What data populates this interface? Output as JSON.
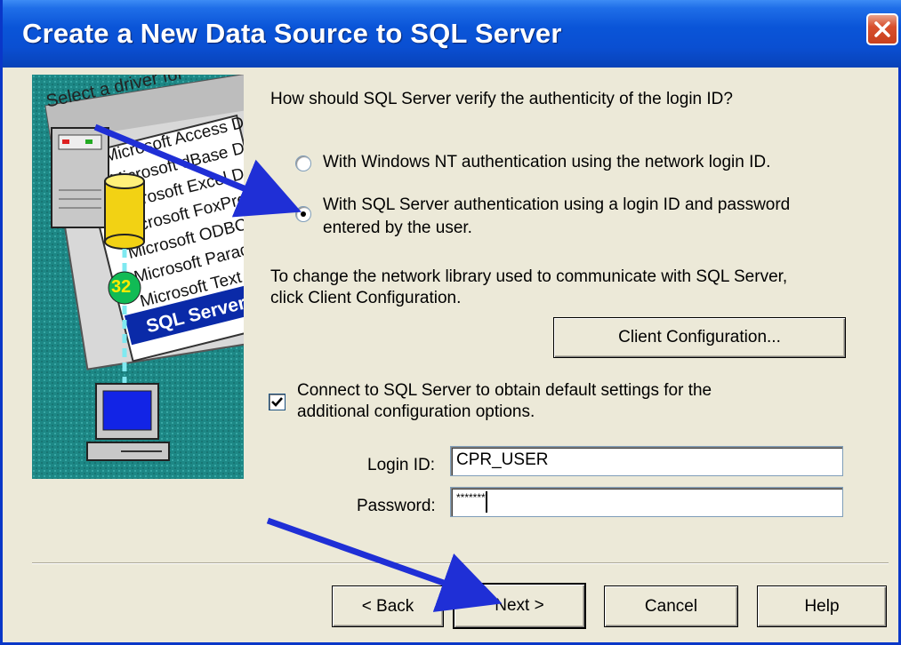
{
  "window": {
    "title": "Create a New Data Source to SQL Server",
    "close_icon": "close-icon"
  },
  "illustration": {
    "header": "Select a driver for",
    "driver_list": [
      "Microsoft Access D",
      "Microsoft dBase D",
      "Microsoft Excel D",
      "Microsoft FoxPro",
      "Microsoft ODBC",
      "Microsoft Parad",
      "Microsoft Text",
      "SQL Server"
    ],
    "badge": "32"
  },
  "auth": {
    "question": "How should SQL Server verify the authenticity of the login ID?",
    "option_nt": "With Windows NT authentication using the network login ID.",
    "option_sql_line1": "With SQL Server authentication using a login ID and password",
    "option_sql_line2": "entered by the user.",
    "selected": "sql"
  },
  "network": {
    "line1": "To change the network library used to communicate with SQL Server,",
    "line2": "click Client Configuration.",
    "client_config_label": "Client Configuration..."
  },
  "connect": {
    "line1": "Connect to SQL Server to obtain default settings for the",
    "line2": "additional configuration options.",
    "checked": true
  },
  "fields": {
    "login_label": "Login ID:",
    "login_value": "CPR_USER",
    "password_label": "Password:",
    "password_value": "*******"
  },
  "buttons": {
    "back": "< Back",
    "next": "Next >",
    "cancel": "Cancel",
    "help": "Help"
  },
  "colors": {
    "titlebar": "#0a4fd2",
    "dialog_bg": "#ece9d8",
    "annotation_arrow": "#1f2fd6"
  }
}
